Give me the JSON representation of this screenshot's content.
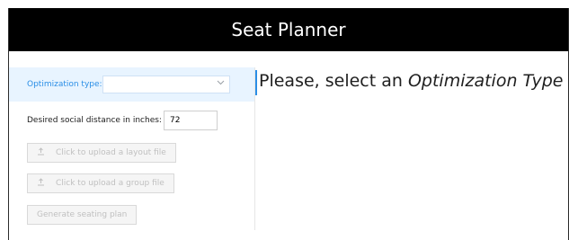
{
  "app": {
    "title": "Seat Planner"
  },
  "form": {
    "optimization_label": "Optimization type:",
    "optimization_value": "",
    "distance_label": "Desired social distance in inches:",
    "distance_value": "72",
    "upload_layout_label": "Click to upload a layout file",
    "upload_group_label": "Click to upload a group file",
    "generate_label": "Generate seating plan"
  },
  "main": {
    "message_prefix": "Please, select an ",
    "message_emphasis": "Optimization Type"
  },
  "icons": {
    "select_chevron": "chevron-down-icon",
    "upload": "upload-icon"
  },
  "colors": {
    "header_bg": "#000000",
    "accent": "#2a8ee6",
    "highlight_bg": "#e8f4ff"
  }
}
